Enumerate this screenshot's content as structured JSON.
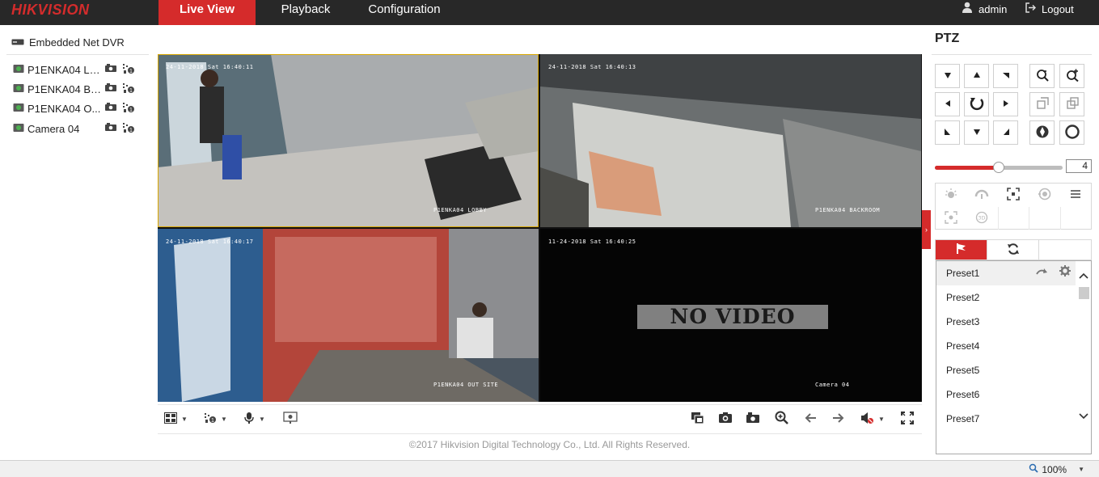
{
  "app": {
    "logo": "HIKVISION"
  },
  "nav": {
    "tabs": [
      {
        "label": "Live View",
        "active": true
      },
      {
        "label": "Playback"
      },
      {
        "label": "Configuration"
      }
    ]
  },
  "user": {
    "name": "admin",
    "logout": "Logout"
  },
  "sidebar": {
    "device": "Embedded Net DVR",
    "cameras": [
      {
        "label": "P1ENKA04 LO..."
      },
      {
        "label": "P1ENKA04 BA..."
      },
      {
        "label": "P1ENKA04 O..."
      },
      {
        "label": "Camera 04"
      }
    ]
  },
  "views": [
    {
      "timestamp": "24-11-2018 Sat 16:40:11",
      "name": "P1ENKA04 LOBBY"
    },
    {
      "timestamp": "24-11-2018 Sat 16:40:13",
      "name": "P1ENKA04 BACKROOM"
    },
    {
      "timestamp": "24-11-2018 Sat 16:40:17",
      "name": "P1ENKA04 OUT SITE"
    },
    {
      "timestamp": "11-24-2018 Sat 16:40:25",
      "name": "Camera 04",
      "status": "NO VIDEO"
    }
  ],
  "footer": "©2017 Hikvision Digital Technology Co., Ltd. All Rights Reserved.",
  "ptz": {
    "title": "PTZ",
    "speed": "4",
    "speed_fraction": 0.5,
    "presets": [
      "Preset1",
      "Preset2",
      "Preset3",
      "Preset4",
      "Preset5",
      "Preset6",
      "Preset7"
    ]
  },
  "status": {
    "zoom": "100%"
  },
  "colors": {
    "accent": "#d52b2b",
    "topbar": "#282828",
    "selection": "#d9a700"
  }
}
